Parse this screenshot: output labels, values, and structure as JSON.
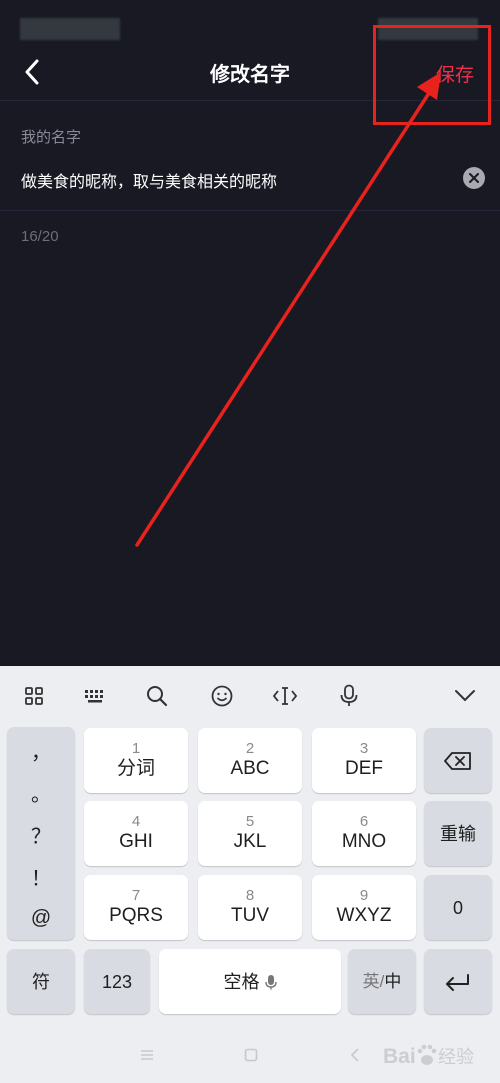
{
  "header": {
    "title": "修改名字",
    "save_label": "保存",
    "back_icon": "chevron-left-icon"
  },
  "form": {
    "label": "我的名字",
    "name_value": "做美食的昵称，取与美食相关的昵称",
    "char_count": "16/20"
  },
  "keyboard": {
    "toolbar_icons": [
      "grid-icon",
      "keyboard-icon",
      "search-icon",
      "emoji-icon",
      "cursor-icon",
      "microphone-icon",
      "chevron-down-icon"
    ],
    "punctuation": [
      "，",
      "。",
      "？",
      "！",
      "@"
    ],
    "keys": [
      {
        "num": "1",
        "label": "分词"
      },
      {
        "num": "2",
        "label": "ABC"
      },
      {
        "num": "3",
        "label": "DEF"
      },
      {
        "num": "4",
        "label": "GHI"
      },
      {
        "num": "5",
        "label": "JKL"
      },
      {
        "num": "6",
        "label": "MNO"
      },
      {
        "num": "7",
        "label": "PQRS"
      },
      {
        "num": "8",
        "label": "TUV"
      },
      {
        "num": "9",
        "label": "WXYZ"
      }
    ],
    "reenter_label": "重输",
    "zero_label": "0",
    "symbol_label": "符",
    "numeric_label": "123",
    "space_label": "空格",
    "lang_en": "英",
    "lang_sep": "/",
    "lang_zh": "中"
  },
  "watermark": {
    "brand": "Bai",
    "brand_suffix": "经验"
  },
  "colors": {
    "background": "#191924",
    "accent": "#f0304a",
    "annotation": "#e8231d",
    "keyboard_bg": "#eceef2"
  }
}
